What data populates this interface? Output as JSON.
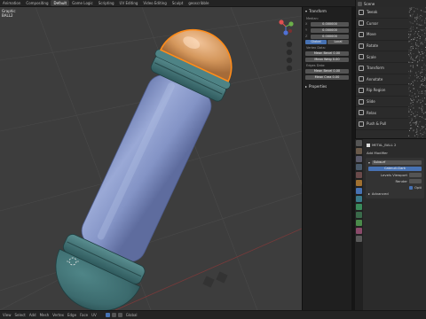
{
  "topbar": {
    "tabs": [
      "Animation",
      "Compositing",
      "Default",
      "Game Logic",
      "Scripting",
      "UV Editing",
      "Video Editing",
      "Sculpt",
      "geoscribble"
    ],
    "active_tab": "Default",
    "scene": "Scene"
  },
  "viewport": {
    "info_line1": "Graphic",
    "info_line2": "BALL2"
  },
  "npanel": {
    "transform_header": "Transform",
    "median_label": "Median:",
    "x": "0.000000",
    "y": "0.000000",
    "z": "0.000000",
    "global_label": "Global",
    "local_label": "Local",
    "vertex_data_label": "Vertex Data:",
    "mean_bevel_1": "Mean Bevel",
    "mean_bevel_1_val": "0.00",
    "mean_weight": "Mean Weig",
    "mean_weight_val": "0.00",
    "edges_data_label": "Edges Data:",
    "mean_bevel_2": "Mean Bevel",
    "mean_bevel_2_val": "0.00",
    "mean_crease": "Mean Crea",
    "mean_crease_val": "0.00",
    "properties_header": "Properties"
  },
  "tools": [
    "Tweak",
    "Cursor",
    "Move",
    "Rotate",
    "Scale",
    "Transform",
    "Annotate",
    "Rip Region",
    "Slide",
    "Relax",
    "Push & Pull"
  ],
  "properties": {
    "object_name": "METAL_BALL 2",
    "add_modifier": "Add Modifier",
    "modifier_name": "Subsurf",
    "catmull_clark": "Catmull-Clark",
    "levels_viewport": "Levels Viewport",
    "render": "Render",
    "optimal": "Opti",
    "advanced": "Advanced"
  },
  "statusbar": {
    "items": [
      "View",
      "Select",
      "Add",
      "Mesh",
      "Vertex",
      "Edge",
      "Face",
      "UV"
    ],
    "global_label": "Global"
  },
  "colors": {
    "viewport_bg": "#3d3d3d",
    "body_tube": "#8f9fcf",
    "cap_teal": "#3f7073",
    "glass_dome": "#d4975c",
    "selection_orange": "#ff8c1a",
    "accent_blue": "#4772b3"
  }
}
